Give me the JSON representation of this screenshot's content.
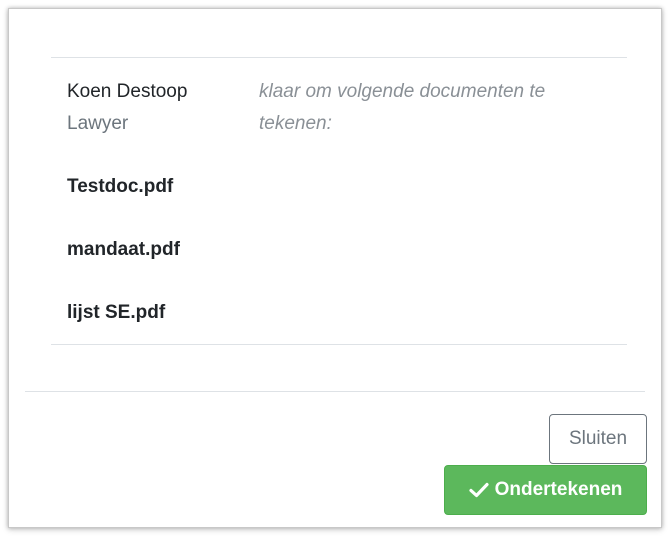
{
  "signer": {
    "name": "Koen Destoop",
    "role": "Lawyer"
  },
  "message": "klaar om volgende documenten te tekenen:",
  "documents": [
    "Testdoc.pdf",
    "mandaat.pdf",
    "lijst SE.pdf"
  ],
  "buttons": {
    "close_label": "Sluiten",
    "sign_label": "Ondertekenen",
    "sign_icon": "check-icon"
  },
  "colors": {
    "sign_button": "#5cb85c",
    "close_button_border": "#6c757d"
  }
}
